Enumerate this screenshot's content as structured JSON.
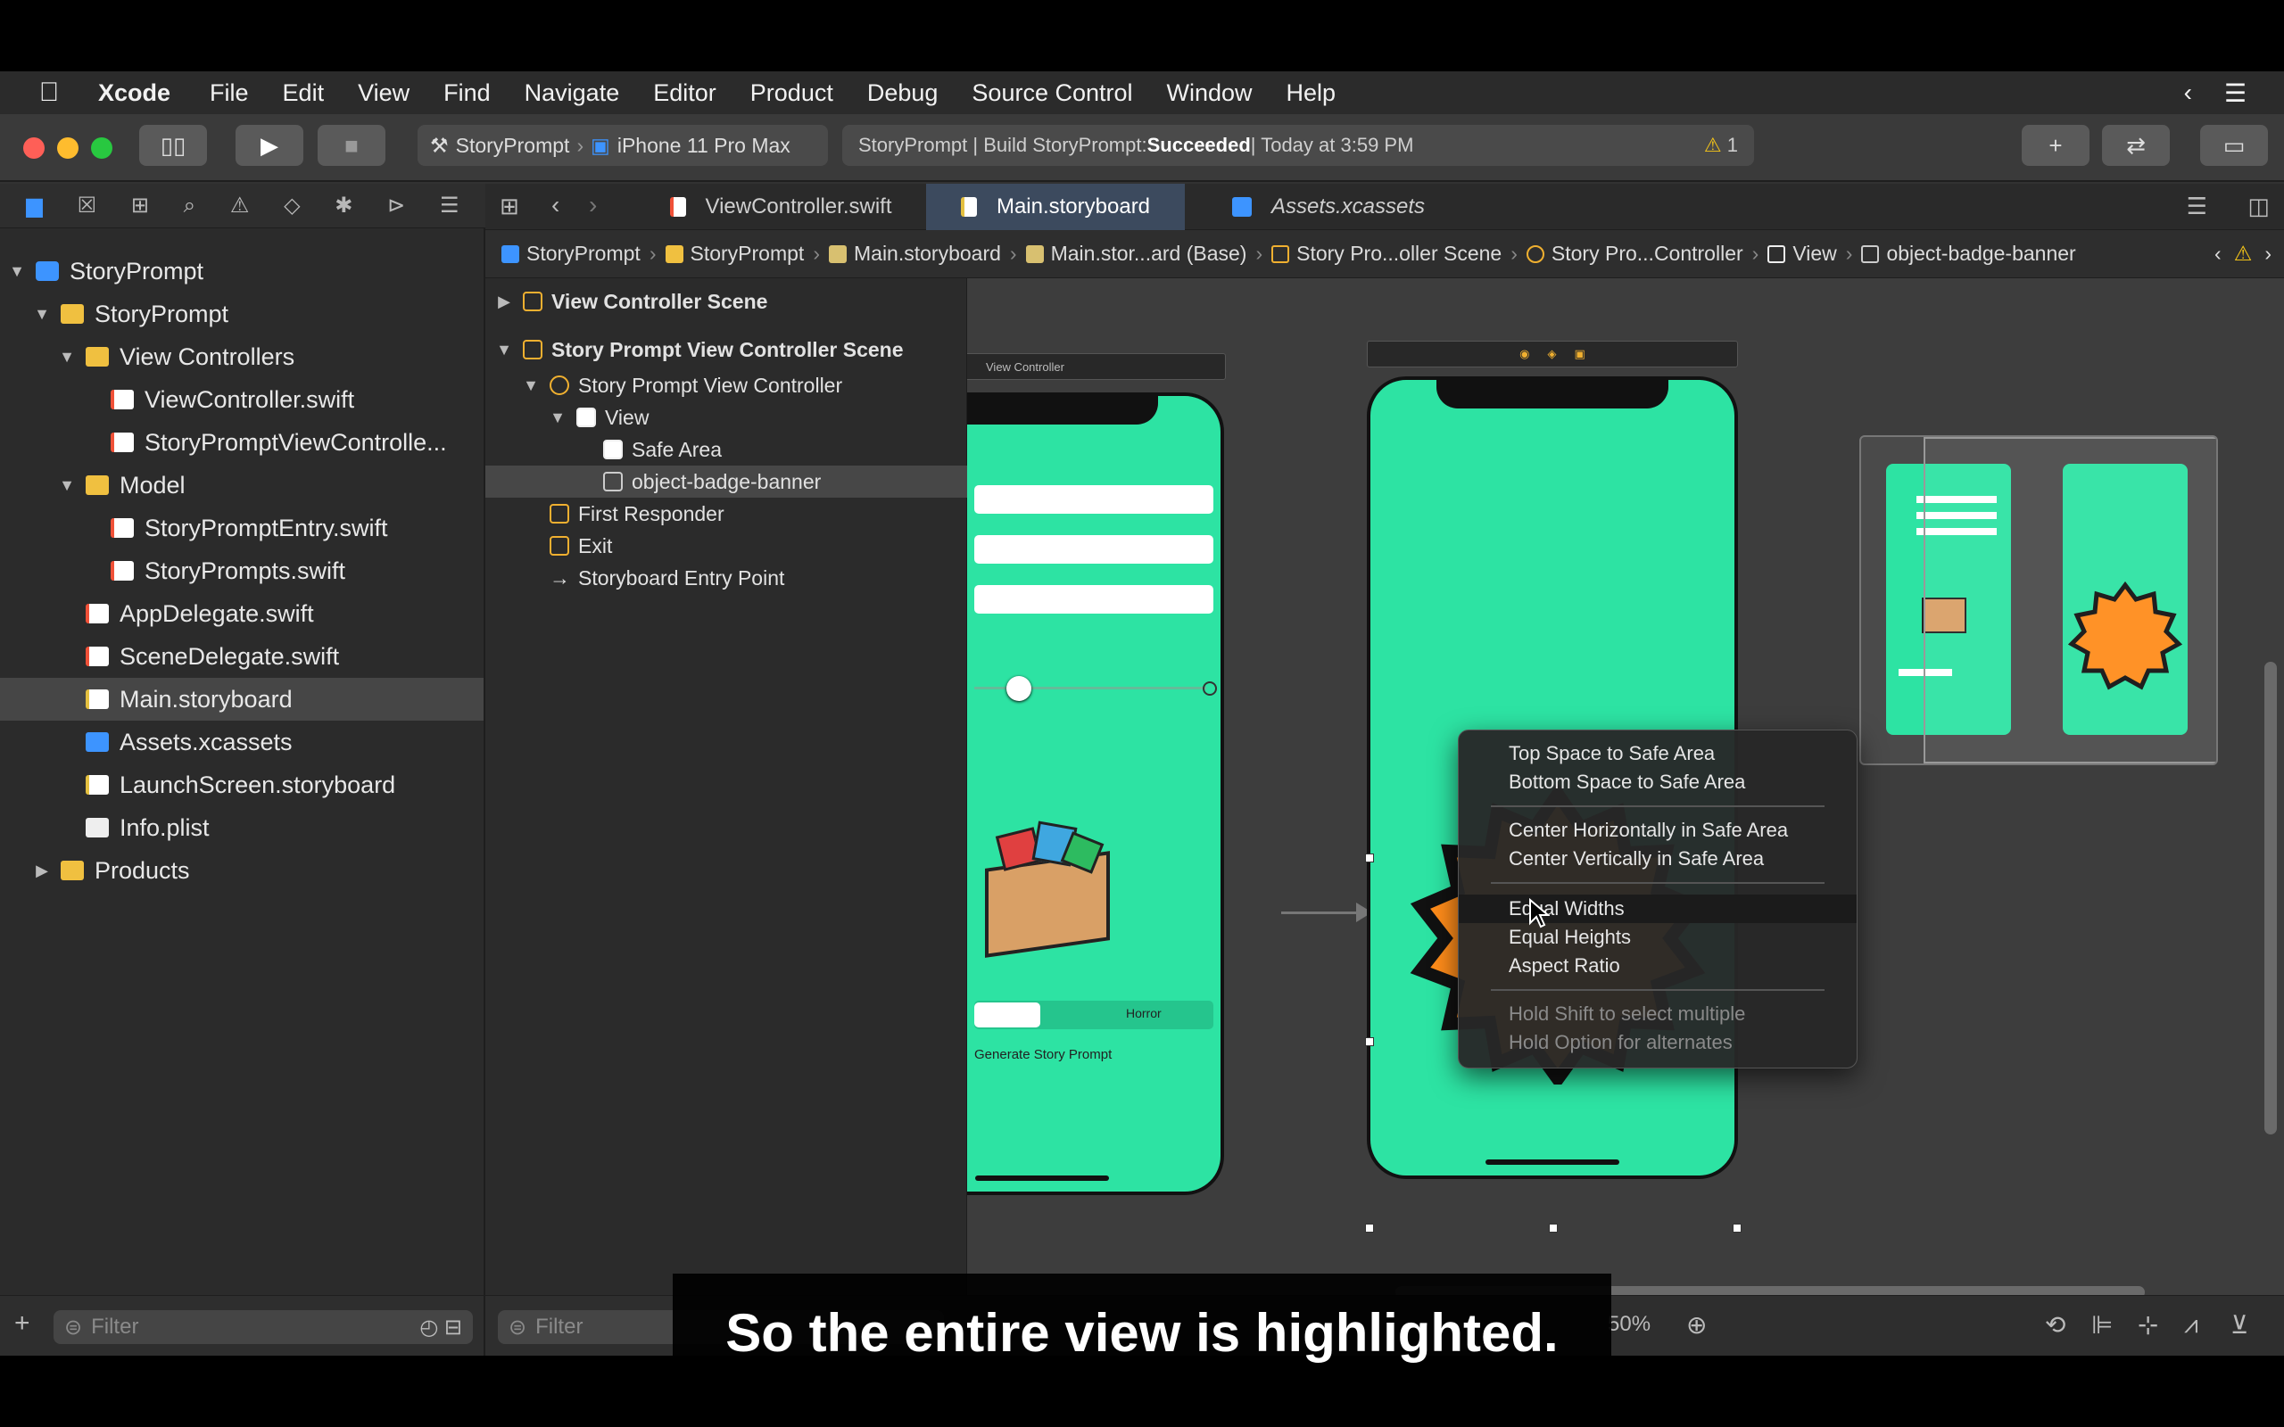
{
  "menubar": {
    "apple": "",
    "items": [
      "Xcode",
      "File",
      "Edit",
      "View",
      "Find",
      "Navigate",
      "Editor",
      "Product",
      "Debug",
      "Source Control",
      "Window",
      "Help"
    ]
  },
  "toolbar": {
    "scheme_target": "StoryPrompt",
    "scheme_device": "iPhone 11 Pro Max",
    "activity_prefix": "StoryPrompt | Build StoryPrompt: ",
    "activity_status": "Succeeded",
    "activity_suffix": " | Today at 3:59 PM",
    "warning_count": "1"
  },
  "navigator": {
    "items": [
      {
        "label": "StoryPrompt",
        "depth": 0,
        "type": "proj",
        "disc": "▼"
      },
      {
        "label": "StoryPrompt",
        "depth": 1,
        "type": "folder",
        "disc": "▼"
      },
      {
        "label": "View Controllers",
        "depth": 2,
        "type": "folder",
        "disc": "▼"
      },
      {
        "label": "ViewController.swift",
        "depth": 3,
        "type": "swift",
        "disc": ""
      },
      {
        "label": "StoryPromptViewControlle...",
        "depth": 3,
        "type": "swift",
        "disc": ""
      },
      {
        "label": "Model",
        "depth": 2,
        "type": "folder",
        "disc": "▼"
      },
      {
        "label": "StoryPromptEntry.swift",
        "depth": 3,
        "type": "swift",
        "disc": ""
      },
      {
        "label": "StoryPrompts.swift",
        "depth": 3,
        "type": "swift",
        "disc": ""
      },
      {
        "label": "AppDelegate.swift",
        "depth": 2,
        "type": "swift",
        "disc": ""
      },
      {
        "label": "SceneDelegate.swift",
        "depth": 2,
        "type": "swift",
        "disc": ""
      },
      {
        "label": "Main.storyboard",
        "depth": 2,
        "type": "sb",
        "disc": "",
        "selected": true
      },
      {
        "label": "Assets.xcassets",
        "depth": 2,
        "type": "asset",
        "disc": ""
      },
      {
        "label": "LaunchScreen.storyboard",
        "depth": 2,
        "type": "sb",
        "disc": ""
      },
      {
        "label": "Info.plist",
        "depth": 2,
        "type": "plist",
        "disc": ""
      },
      {
        "label": "Products",
        "depth": 1,
        "type": "folder",
        "disc": "▶"
      }
    ],
    "filter_placeholder": "Filter"
  },
  "tabs": [
    {
      "label": "ViewController.swift",
      "active": false
    },
    {
      "label": "Main.storyboard",
      "active": true
    },
    {
      "label": "Assets.xcassets",
      "active": false
    }
  ],
  "jumpbar": [
    "StoryPrompt",
    "StoryPrompt",
    "Main.storyboard",
    "Main.stor...ard (Base)",
    "Story Pro...oller Scene",
    "Story Pro...Controller",
    "View",
    "object-badge-banner"
  ],
  "outline": {
    "items": [
      {
        "label": "View Controller Scene",
        "depth": 0,
        "disc": "▶",
        "bold": true,
        "icon": "scene"
      },
      {
        "label": "Story Prompt View Controller Scene",
        "depth": 0,
        "disc": "▼",
        "bold": true,
        "icon": "scene"
      },
      {
        "label": "Story Prompt View Controller",
        "depth": 1,
        "disc": "▼",
        "icon": "controller"
      },
      {
        "label": "View",
        "depth": 2,
        "disc": "▼",
        "icon": "view"
      },
      {
        "label": "Safe Area",
        "depth": 3,
        "disc": "",
        "icon": "safe"
      },
      {
        "label": "object-badge-banner",
        "depth": 3,
        "disc": "",
        "icon": "img",
        "selected": true
      },
      {
        "label": "First Responder",
        "depth": 1,
        "disc": "",
        "icon": "responder"
      },
      {
        "label": "Exit",
        "depth": 1,
        "disc": "",
        "icon": "exit"
      },
      {
        "label": "Storyboard Entry Point",
        "depth": 1,
        "disc": "",
        "icon": "arrow"
      }
    ],
    "filter_placeholder": "Filter"
  },
  "canvas": {
    "left_scene_title": "View Controller",
    "genre_label": "Horror",
    "generate_label": "Generate Story Prompt",
    "zoom": "50%"
  },
  "context_menu": {
    "groups": [
      [
        "Top Space to Safe Area",
        "Bottom Space to Safe Area"
      ],
      [
        "Center Horizontally in Safe Area",
        "Center Vertically in Safe Area"
      ],
      [
        "Equal Widths",
        "Equal Heights",
        "Aspect Ratio"
      ],
      [
        "Hold Shift to select multiple",
        "Hold Option for alternates"
      ]
    ],
    "highlighted": "Equal Widths"
  },
  "caption": "So the entire view is highlighted.",
  "colors": {
    "accent": "#3d94ff",
    "phone": "#2de3a3",
    "badge": "#ff8c1a"
  }
}
